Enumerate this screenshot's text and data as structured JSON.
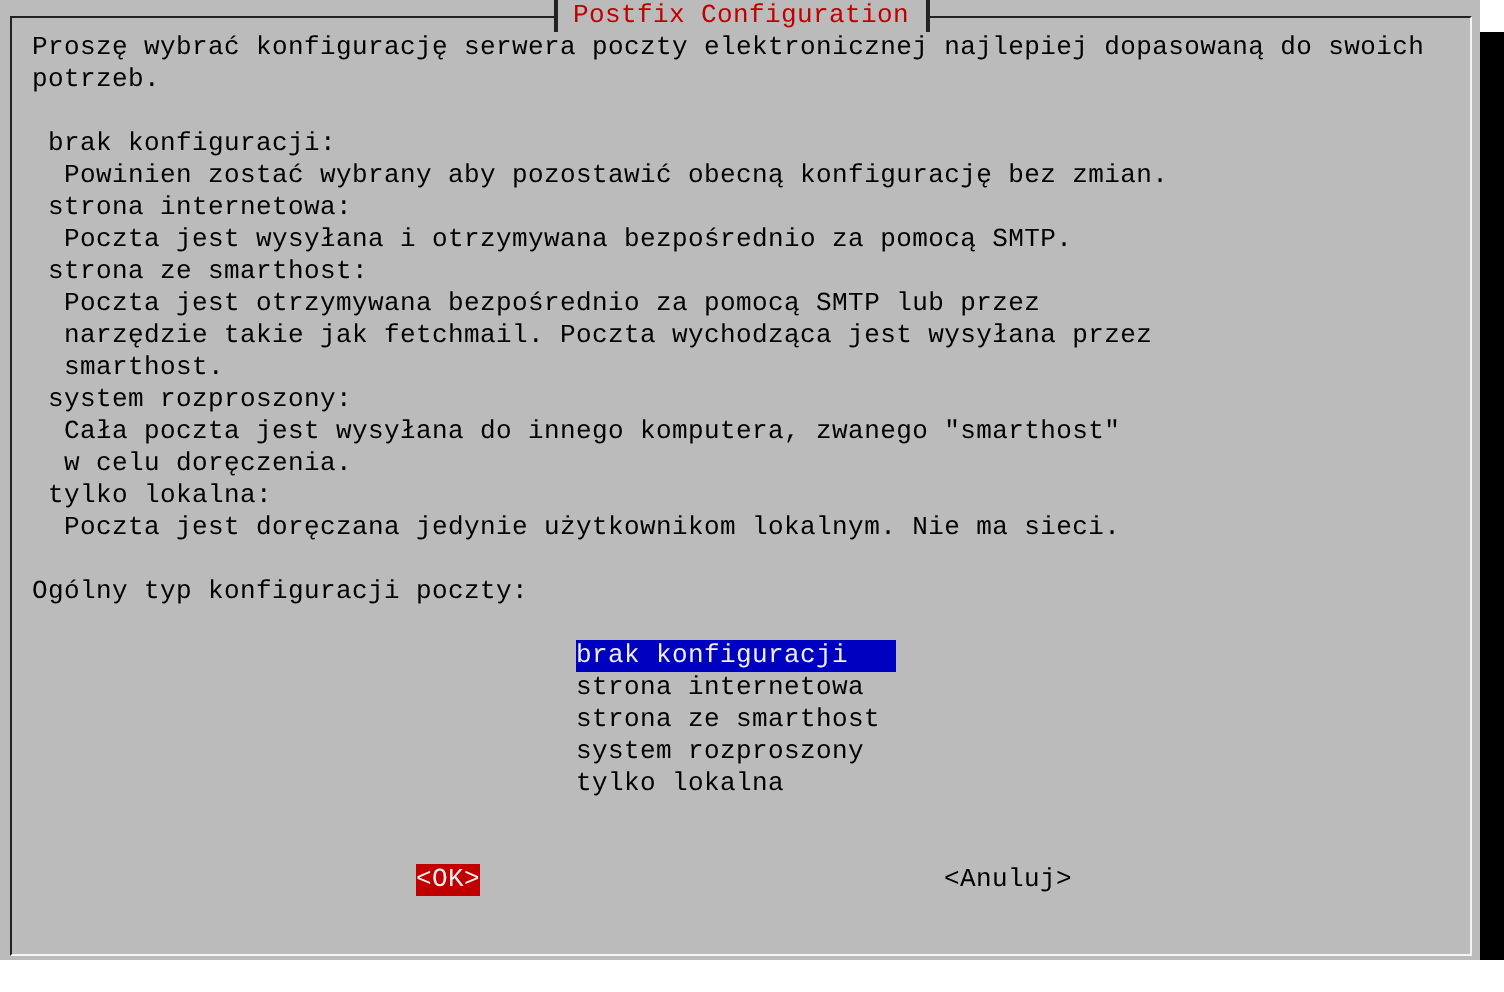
{
  "dialog": {
    "title": "Postfix Configuration",
    "intro": [
      "Proszę wybrać konfigurację serwera poczty elektronicznej najlepiej dopasowaną do swoich",
      "potrzeb."
    ],
    "options": [
      {
        "name": "brak konfiguracji:",
        "description": [
          "Powinien zostać wybrany aby pozostawić obecną konfigurację bez zmian."
        ]
      },
      {
        "name": "strona internetowa:",
        "description": [
          "Poczta jest wysyłana i otrzymywana bezpośrednio za pomocą SMTP."
        ]
      },
      {
        "name": "strona ze smarthost:",
        "description": [
          "Poczta jest otrzymywana bezpośrednio za pomocą SMTP lub przez",
          "narzędzie takie jak fetchmail. Poczta wychodząca jest wysyłana przez",
          "smarthost."
        ]
      },
      {
        "name": "system rozproszony:",
        "description": [
          "Cała poczta jest wysyłana do innego komputera, zwanego \"smarthost\"",
          "w celu doręczenia."
        ]
      },
      {
        "name": "tylko lokalna:",
        "description": [
          "Poczta jest doręczana jedynie użytkownikom lokalnym. Nie ma sieci."
        ]
      }
    ],
    "prompt": "Ogólny typ konfiguracji poczty:",
    "menu": [
      {
        "label": "brak konfiguracji",
        "selected": true
      },
      {
        "label": "strona internetowa",
        "selected": false
      },
      {
        "label": "strona ze smarthost",
        "selected": false
      },
      {
        "label": "system rozproszony",
        "selected": false
      },
      {
        "label": "tylko lokalna",
        "selected": false
      }
    ],
    "buttons": [
      {
        "label": "<OK>",
        "selected": true
      },
      {
        "label": "<Anuluj>",
        "selected": false
      }
    ]
  }
}
